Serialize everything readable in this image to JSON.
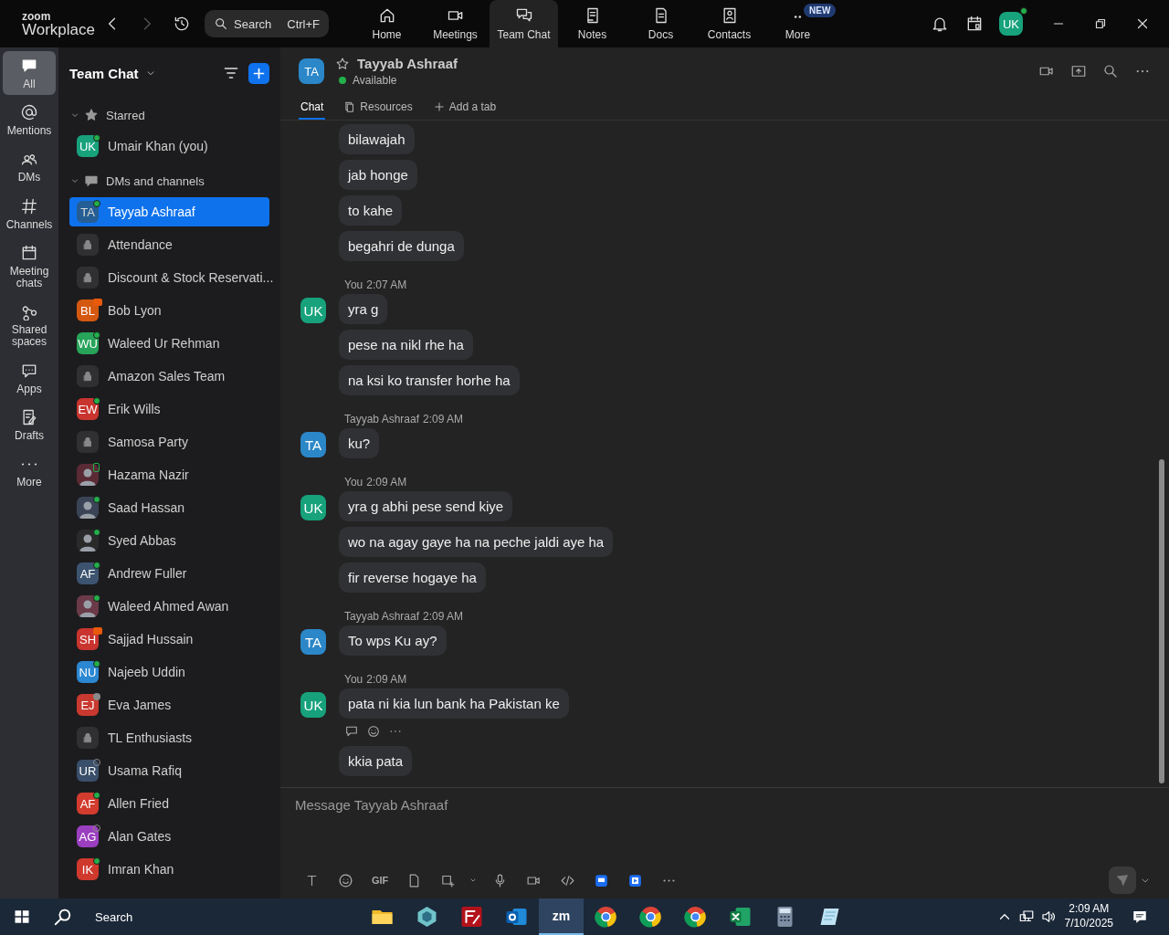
{
  "app": {
    "brand": "zoom",
    "product": "Workplace"
  },
  "search": {
    "placeholder": "Search",
    "shortcut": "Ctrl+F"
  },
  "nav_tabs": [
    {
      "label": "Home",
      "selected": false
    },
    {
      "label": "Meetings",
      "selected": false
    },
    {
      "label": "Team Chat",
      "selected": true
    },
    {
      "label": "Notes",
      "selected": false
    },
    {
      "label": "Docs",
      "selected": false
    },
    {
      "label": "Contacts",
      "selected": false
    },
    {
      "label": "More",
      "selected": false,
      "badge": "NEW"
    }
  ],
  "account": {
    "initials": "UK",
    "color": "#17a27c",
    "presence": {
      "kind": "online"
    }
  },
  "rail": [
    {
      "label": "All",
      "selected": true
    },
    {
      "label": "Mentions",
      "selected": false
    },
    {
      "label": "DMs",
      "selected": false
    },
    {
      "label": "Channels",
      "selected": false
    },
    {
      "label": "Meeting chats",
      "selected": false
    },
    {
      "label": "Shared spaces",
      "selected": false
    },
    {
      "label": "Apps",
      "selected": false
    },
    {
      "label": "Drafts",
      "selected": false
    },
    {
      "label": "More",
      "selected": false
    }
  ],
  "sidebar": {
    "title": "Team Chat",
    "sections": [
      {
        "label": "Starred",
        "expanded": true,
        "items": [
          {
            "kind": "avatar",
            "name": "Umair Khan (you)",
            "initials": "UK",
            "color": "#17a27c",
            "presence": {
              "kind": "online"
            },
            "selected": false
          }
        ]
      },
      {
        "label": "DMs and channels",
        "expanded": true,
        "items": [
          {
            "kind": "avatar",
            "name": "Tayyab Ashraaf",
            "initials": "TA",
            "color": "#2b6fae",
            "presence": {
              "kind": "online"
            },
            "selected": true
          },
          {
            "kind": "channel",
            "name": "Attendance",
            "selected": false
          },
          {
            "kind": "channel",
            "name": "Discount & Stock Reservati...",
            "selected": false
          },
          {
            "kind": "avatar",
            "name": "Bob Lyon",
            "initials": "BL",
            "color": "#d4580f",
            "presence": {
              "kind": "meeting"
            },
            "selected": false
          },
          {
            "kind": "avatar",
            "name": "Waleed Ur Rehman",
            "initials": "WU",
            "color": "#27a35a",
            "presence": {
              "kind": "online"
            },
            "selected": false
          },
          {
            "kind": "channel",
            "name": "Amazon Sales Team",
            "selected": false
          },
          {
            "kind": "avatar",
            "name": "Erik Wills",
            "initials": "EW",
            "color": "#c9342f",
            "presence": {
              "kind": "online"
            },
            "selected": false
          },
          {
            "kind": "channel",
            "name": "Samosa Party",
            "selected": false
          },
          {
            "kind": "photo",
            "name": "Hazama Nazir",
            "color": "#5a2a35",
            "presence": {
              "kind": "mobile"
            },
            "selected": false
          },
          {
            "kind": "photo",
            "name": "Saad Hassan",
            "color": "#3a4456",
            "presence": {
              "kind": "online"
            },
            "selected": false
          },
          {
            "kind": "photo",
            "name": "Syed Abbas",
            "color": "#2a2a2a",
            "presence": {
              "kind": "online"
            },
            "selected": false
          },
          {
            "kind": "avatar",
            "name": "Andrew Fuller",
            "initials": "AF",
            "color": "#3d5470",
            "presence": {
              "kind": "online"
            },
            "selected": false
          },
          {
            "kind": "photo",
            "name": "Waleed Ahmed Awan",
            "color": "#6a3a48",
            "presence": {
              "kind": "online"
            },
            "selected": false
          },
          {
            "kind": "avatar",
            "name": "Sajjad Hussain",
            "initials": "SH",
            "color": "#c9342f",
            "presence": {
              "kind": "meeting"
            },
            "selected": false
          },
          {
            "kind": "avatar",
            "name": "Najeeb Uddin",
            "initials": "NU",
            "color": "#2b87d1",
            "presence": {
              "kind": "online"
            },
            "selected": false
          },
          {
            "kind": "avatar",
            "name": "Eva James",
            "initials": "EJ",
            "color": "#c9392f",
            "presence": {
              "kind": "away"
            },
            "selected": false
          },
          {
            "kind": "channel",
            "name": "TL Enthusiasts",
            "selected": false
          },
          {
            "kind": "avatar",
            "name": "Usama Rafiq",
            "initials": "UR",
            "color": "#3a4f6a",
            "presence": {
              "kind": "offline"
            },
            "selected": false
          },
          {
            "kind": "avatar",
            "name": "Allen Fried",
            "initials": "AF",
            "color": "#d23b2e",
            "presence": {
              "kind": "online"
            },
            "selected": false
          },
          {
            "kind": "avatar",
            "name": "Alan Gates",
            "initials": "AG",
            "color": "#9b3fc0",
            "presence": {
              "kind": "offline"
            },
            "selected": false
          },
          {
            "kind": "avatar",
            "name": "Imran Khan",
            "initials": "IK",
            "color": "#d0392e",
            "presence": {
              "kind": "online"
            },
            "selected": false
          }
        ]
      }
    ]
  },
  "chat": {
    "initials": "TA",
    "color": "#2b87c8",
    "name": "Tayyab Ashraaf",
    "starred": false,
    "status": "Available",
    "tabs": [
      {
        "label": "Chat",
        "selected": true
      },
      {
        "label": "Resources",
        "selected": false
      },
      {
        "label": "Add a tab",
        "selected": false
      }
    ],
    "groups": [
      {
        "messages": [
          {
            "text": "bilawajah"
          },
          {
            "text": "jab honge"
          },
          {
            "text": "to kahe"
          },
          {
            "text": "begahri de dunga"
          }
        ]
      },
      {
        "sender": "You",
        "time": "2:07 AM",
        "initials": "UK",
        "color": "#17a27c",
        "messages": [
          {
            "text": "yra g"
          },
          {
            "text": "pese na nikl rhe ha"
          },
          {
            "text": "na ksi ko transfer horhe ha"
          }
        ]
      },
      {
        "sender": "Tayyab Ashraaf",
        "time": "2:09 AM",
        "initials": "TA",
        "color": "#2b87c8",
        "messages": [
          {
            "text": "ku?"
          }
        ]
      },
      {
        "sender": "You",
        "time": "2:09 AM",
        "initials": "UK",
        "color": "#17a27c",
        "messages": [
          {
            "text": "yra g abhi pese send kiye"
          },
          {
            "text": "wo na agay gaye ha na peche jaldi aye ha"
          },
          {
            "text": "fir reverse hogaye ha"
          }
        ]
      },
      {
        "sender": "Tayyab Ashraaf",
        "time": "2:09 AM",
        "initials": "TA",
        "color": "#2b87c8",
        "messages": [
          {
            "text": "To wps Ku ay?"
          }
        ]
      },
      {
        "sender": "You",
        "time": "2:09 AM",
        "initials": "UK",
        "color": "#17a27c",
        "messages": [
          {
            "text": "pata ni kia lun bank ha Pakistan ke",
            "actions": true
          },
          {
            "text": "kkia pata"
          }
        ]
      }
    ]
  },
  "composer": {
    "placeholder": "Message Tayyab Ashraaf",
    "gif": "GIF"
  },
  "taskbar": {
    "search": "Search",
    "zoom_label": "zm",
    "time": "2:09 AM",
    "date": "7/10/2025"
  }
}
